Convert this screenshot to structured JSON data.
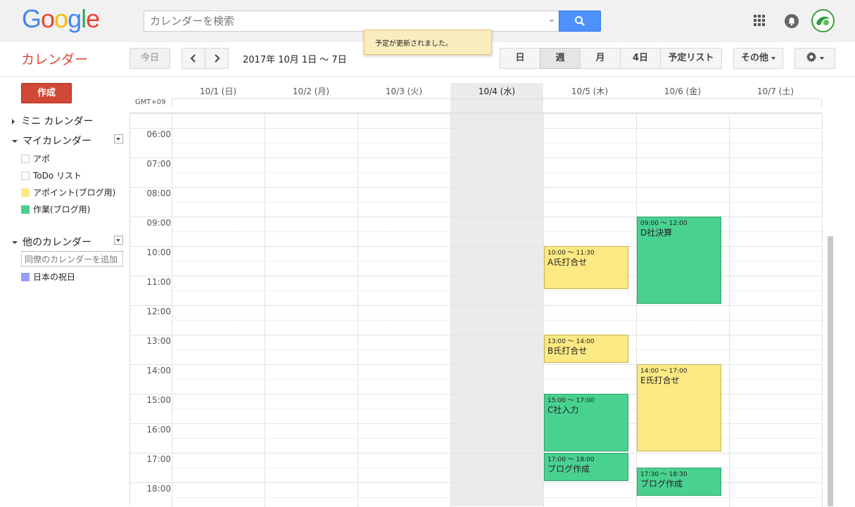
{
  "header": {
    "logo": [
      "G",
      "o",
      "o",
      "g",
      "l",
      "e"
    ],
    "search_placeholder": "カレンダーを検索"
  },
  "toast": "予定が更新されました。",
  "toolbar": {
    "app_title": "カレンダー",
    "today": "今日",
    "date_range": "2017年 10月 1日 ～ 7日",
    "views": {
      "day": "日",
      "week": "週",
      "month": "月",
      "four_day": "4日",
      "agenda": "予定リスト"
    },
    "more": "その他",
    "active_view": "週"
  },
  "sidebar": {
    "create": "作成",
    "mini_calendar": "ミニ カレンダー",
    "my_calendars": "マイカレンダー",
    "my_items": [
      {
        "label": "アポ",
        "color": "#ffffff"
      },
      {
        "label": "ToDo リスト",
        "color": "#ffffff"
      },
      {
        "label": "アポイント(ブログ用)",
        "color": "#fbe983"
      },
      {
        "label": "作業(ブログ用)",
        "color": "#49d190"
      }
    ],
    "other_calendars": "他のカレンダー",
    "add_placeholder": "同僚のカレンダーを追加",
    "other_items": [
      {
        "label": "日本の祝日",
        "color": "#9a9cff"
      }
    ]
  },
  "calendar": {
    "timezone": "GMT+09",
    "days": [
      "10/1 (日)",
      "10/2 (月)",
      "10/3 (火)",
      "10/4 (水)",
      "10/5 (木)",
      "10/6 (金)",
      "10/7 (土)"
    ],
    "today_index": 3,
    "hours": [
      "06:00",
      "07:00",
      "08:00",
      "09:00",
      "10:00",
      "11:00",
      "12:00",
      "13:00",
      "14:00",
      "15:00",
      "16:00",
      "17:00",
      "18:00"
    ],
    "events": [
      {
        "day": 4,
        "time": "10:00 ～ 11:30",
        "title": "A氏打合せ",
        "start": 10.0,
        "end": 11.5,
        "color": "#fbe983"
      },
      {
        "day": 4,
        "time": "13:00 ～ 14:00",
        "title": "B氏打合せ",
        "start": 13.0,
        "end": 14.0,
        "color": "#fbe983"
      },
      {
        "day": 4,
        "time": "15:00 ～ 17:00",
        "title": "C社入力",
        "start": 15.0,
        "end": 17.0,
        "color": "#49d190"
      },
      {
        "day": 4,
        "time": "17:00 ～ 18:00",
        "title": "ブログ作成",
        "start": 17.0,
        "end": 18.0,
        "color": "#49d190"
      },
      {
        "day": 5,
        "time": "09:00 ～ 12:00",
        "title": "D社決算",
        "start": 9.0,
        "end": 12.0,
        "color": "#49d190"
      },
      {
        "day": 5,
        "time": "14:00 ～ 17:00",
        "title": "E氏打合せ",
        "start": 14.0,
        "end": 17.0,
        "color": "#fbe983"
      },
      {
        "day": 5,
        "time": "17:30 ～ 18:30",
        "title": "ブログ作成",
        "start": 17.5,
        "end": 18.5,
        "color": "#49d190"
      }
    ]
  }
}
